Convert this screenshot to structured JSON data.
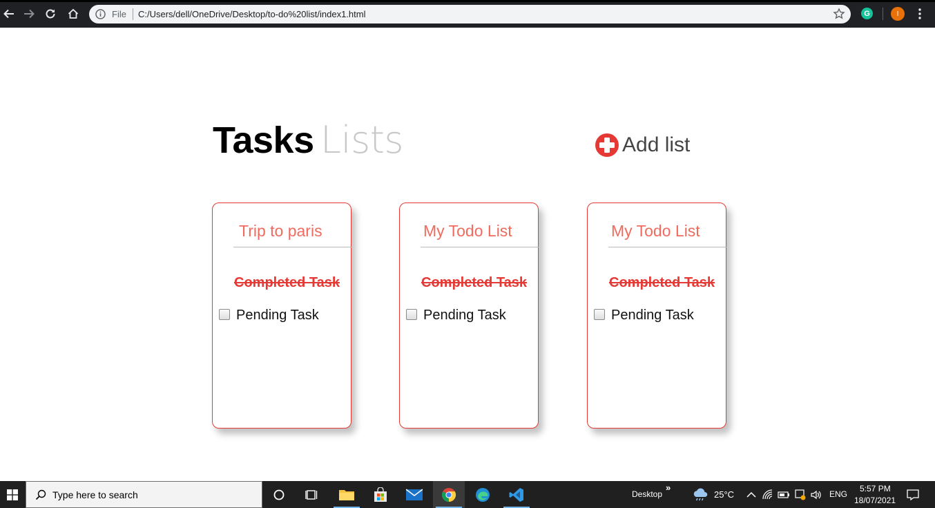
{
  "browser": {
    "scheme_label": "File",
    "url": "C:/Users/dell/OneDrive/Desktop/to-do%20list/index1.html",
    "extension_letter": "G",
    "profile_letter": "I"
  },
  "page": {
    "tab_tasks": "Tasks",
    "tab_lists": "Lists",
    "add_list_label": "Add list",
    "lists": [
      {
        "title": "Trip to paris",
        "completed_task": "Completed Task",
        "pending_task": "Pending Task",
        "pending_checked": false
      },
      {
        "title": "My Todo List",
        "completed_task": "Completed Task",
        "pending_task": "Pending Task",
        "pending_checked": false
      },
      {
        "title": "My Todo List",
        "completed_task": "Completed Task",
        "pending_task": "Pending Task",
        "pending_checked": false
      }
    ]
  },
  "taskbar": {
    "search_placeholder": "Type here to search",
    "desktop_label": "Desktop",
    "chevron_label": "»",
    "weather_temp": "25°C",
    "language": "ENG",
    "time": "5:57 PM",
    "date": "18/07/2021"
  },
  "colors": {
    "accent_red": "#e53935",
    "title_red": "#ef6b5f",
    "lists_grey": "#c8c8c8"
  }
}
